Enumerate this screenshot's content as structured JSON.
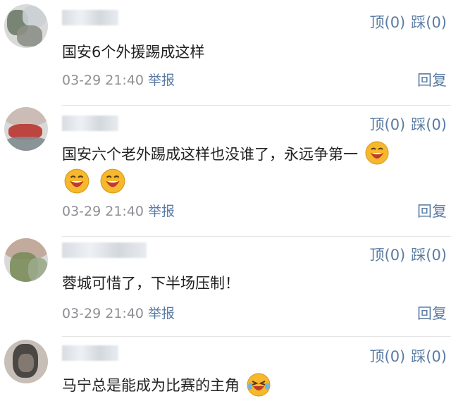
{
  "comments": [
    {
      "up_label": "顶(0)",
      "down_label": "踩(0)",
      "text": "国安6个外援踢成这样",
      "time": "03-29 21:40",
      "report": "举报",
      "reply": "回复",
      "avatar_colors": [
        "#6d7a68",
        "#c9cfd4",
        "#8c8f86"
      ]
    },
    {
      "up_label": "顶(0)",
      "down_label": "踩(0)",
      "text": "国安六个老外踢成这样也没谁了，永远争第一",
      "emoji_count": 3,
      "emoji_name": "laughing-face-icon",
      "time": "03-29 21:40",
      "report": "举报",
      "reply": "回复",
      "avatar_colors": [
        "#b8342f",
        "#7f8c8f",
        "#c9b9b1"
      ]
    },
    {
      "up_label": "顶(0)",
      "down_label": "踩(0)",
      "text": "蓉城可惜了，下半场压制！",
      "time": "03-29 21:40",
      "report": "举报",
      "reply": "回复",
      "avatar_colors": [
        "#7a8c5a",
        "#bfa596",
        "#9aa889"
      ]
    },
    {
      "up_label": "顶(0)",
      "down_label": "踩(0)",
      "text": "马宁总是能成为比赛的主角",
      "emoji_name": "crying-laughing-face-icon",
      "avatar_colors": [
        "#3d3a38",
        "#8b7e74",
        "#c4bbb3"
      ]
    }
  ],
  "colors": {
    "accent": "#5b7ca3",
    "meta": "#8d8f93",
    "text": "#222222",
    "emoji_yellow": "#f6b82c",
    "emoji_mouth": "#c0392b"
  }
}
